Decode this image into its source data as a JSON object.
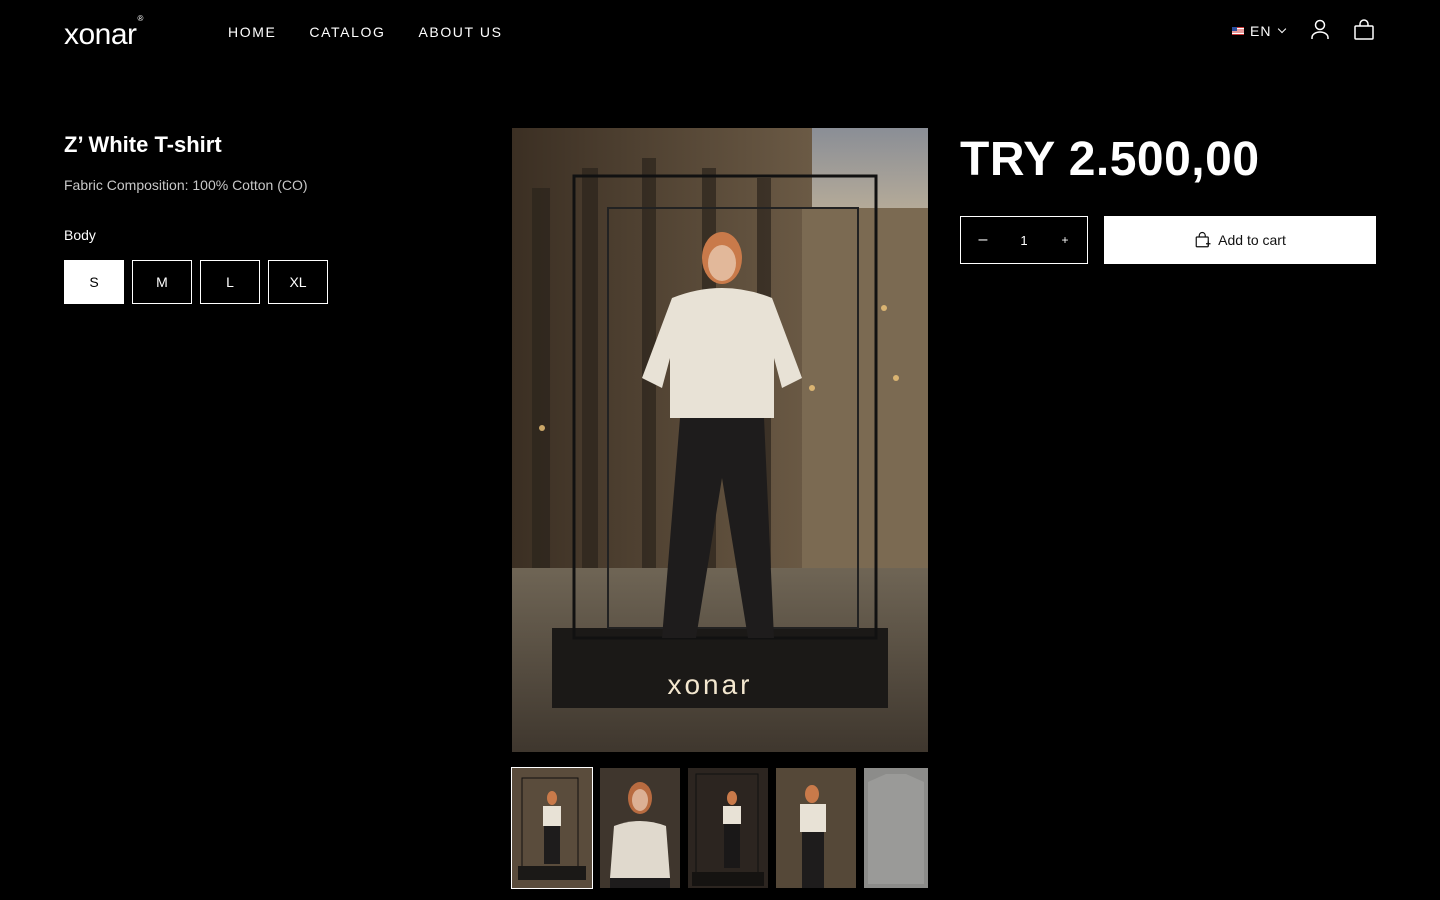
{
  "header": {
    "logo": "xonar",
    "logo_mark": "®",
    "nav": [
      {
        "label": "HOME"
      },
      {
        "label": "CATALOG"
      },
      {
        "label": "ABOUT US"
      }
    ],
    "language": "EN",
    "icons": [
      "us-flag-icon",
      "chevron-down-icon",
      "user-icon",
      "shopping-bag-icon"
    ]
  },
  "product": {
    "title": "Z’ White T-shirt",
    "composition": "Fabric Composition: 100% Cotton (CO)",
    "size_label": "Body",
    "sizes": [
      "S",
      "M",
      "L",
      "XL"
    ],
    "selected_size": "S",
    "price": "TRY 2.500,00",
    "quantity": "1",
    "add_to_cart": "Add to cart",
    "image_caption": "xonar"
  },
  "colors": {
    "background": "#000000",
    "text": "#ffffff",
    "button_bg": "#ffffff"
  }
}
